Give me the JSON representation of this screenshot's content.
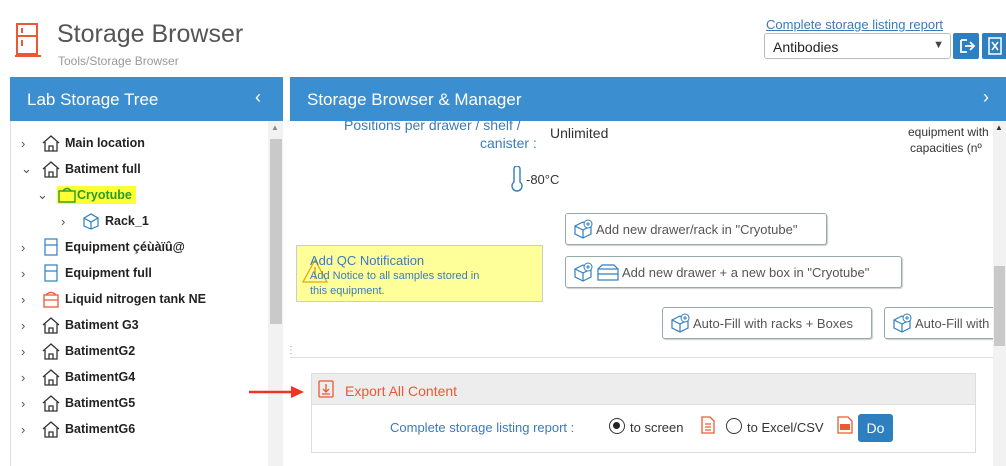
{
  "header": {
    "title": "Storage Browser",
    "path": "Tools/Storage Browser",
    "report_link": "Complete storage listing report",
    "selected_category": "Antibodies",
    "logo_icon": "freezer-icon",
    "accent_color": "#e85a34"
  },
  "left_panel": {
    "title": "Lab Storage Tree",
    "collapse_icon": "chevron-left-icon",
    "tree": [
      {
        "label": "Main location",
        "icon": "home-icon",
        "chevron": "›"
      },
      {
        "label": "Batiment full",
        "icon": "home-icon",
        "chevron": "⌄"
      },
      {
        "label": "Cryotube",
        "icon": "cryotube-icon",
        "chevron": "⌄",
        "selected": true
      },
      {
        "label": "Rack_1",
        "icon": "rack-icon",
        "chevron": "›"
      },
      {
        "label": "Equipment çéùàïû@",
        "icon": "freezer-icon",
        "chevron": "›"
      },
      {
        "label": "Equipment full",
        "icon": "freezer-icon",
        "chevron": "›"
      },
      {
        "label": "Liquid nitrogen tank NE",
        "icon": "tank-icon",
        "chevron": "›"
      },
      {
        "label": "Batiment G3",
        "icon": "home-icon",
        "chevron": "›"
      },
      {
        "label": "BatimentG2",
        "icon": "home-icon",
        "chevron": "›"
      },
      {
        "label": "BatimentG4",
        "icon": "home-icon",
        "chevron": "›"
      },
      {
        "label": "BatimentG5",
        "icon": "home-icon",
        "chevron": "›"
      },
      {
        "label": "BatimentG6",
        "icon": "home-icon",
        "chevron": "›"
      }
    ]
  },
  "right_panel": {
    "title": "Storage Browser & Manager",
    "expand_icon": "chevron-right-icon",
    "positions_label_line1": "Positions per drawer / shelf /",
    "positions_label_line2": "canister :",
    "positions_value": "Unlimited",
    "right_note_line1": "equipment with",
    "right_note_line2": "capacities (nº",
    "temperature": "-80°C",
    "buttons": {
      "add_drawer": "Add new drawer/rack in \"Cryotube\"",
      "add_drawer_box": "Add new drawer + a new box in \"Cryotube\"",
      "autofill_racks_boxes": "Auto-Fill with racks + Boxes",
      "autofill_other": "Auto-Fill with"
    },
    "qc": {
      "title": "Add QC Notification",
      "desc_line1": "Add Notice to all samples stored in",
      "desc_line2": "this equipment."
    },
    "export": {
      "title": "Export All Content",
      "report_label": "Complete storage listing report :",
      "option_screen": "to screen",
      "option_excel": "to Excel/CSV",
      "do_button": "Do",
      "selected_option": "to screen"
    }
  }
}
